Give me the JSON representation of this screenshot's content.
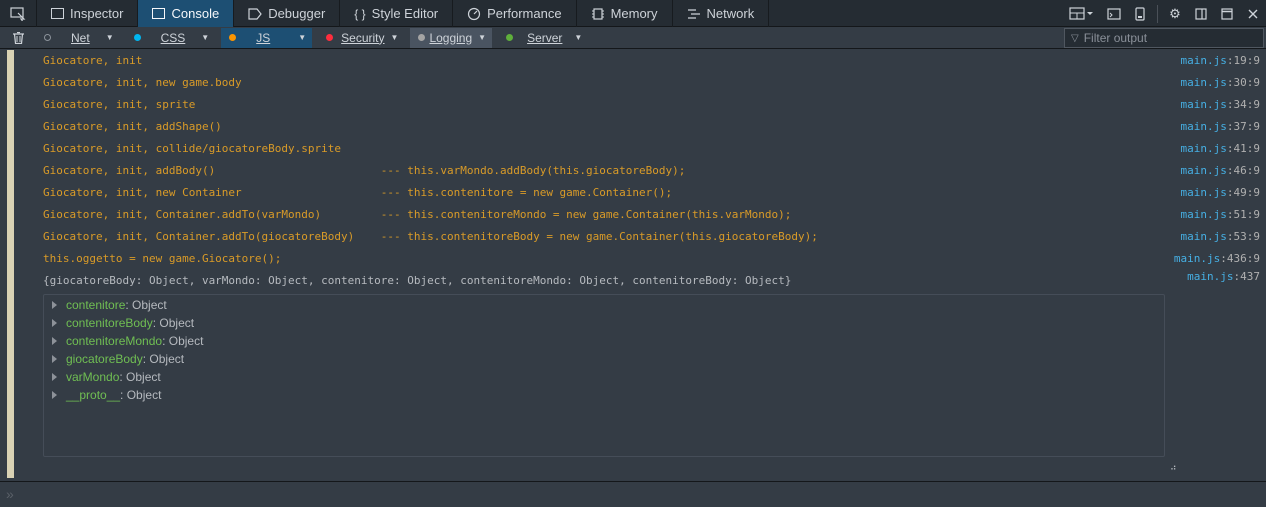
{
  "tabs": [
    {
      "label": "Inspector",
      "icon": "inspector-icon"
    },
    {
      "label": "Console",
      "icon": "console-icon"
    },
    {
      "label": "Debugger",
      "icon": "debugger-icon"
    },
    {
      "label": "Style Editor",
      "icon": "braces-icon"
    },
    {
      "label": "Performance",
      "icon": "performance-icon"
    },
    {
      "label": "Memory",
      "icon": "memory-icon"
    },
    {
      "label": "Network",
      "icon": "network-icon"
    }
  ],
  "selected_tab": "Console",
  "filters": [
    {
      "label": "Net",
      "dot_color": "#8c939b"
    },
    {
      "label": "CSS",
      "dot_color": "#00b6f0"
    },
    {
      "label": "JS",
      "dot_color": "#fb9500"
    },
    {
      "label": "Security",
      "dot_color": "#ff2d3d"
    },
    {
      "label": "Logging",
      "dot_color": "#a4a4a4"
    },
    {
      "label": "Server",
      "dot_color": "#5faf3b"
    }
  ],
  "filter_output": {
    "placeholder": "Filter output",
    "value": ""
  },
  "messages": [
    {
      "text": "Giocatore, init",
      "file": "main.js",
      "loc": ":19:9",
      "kind": "log"
    },
    {
      "text": "Giocatore, init, new game.body",
      "file": "main.js",
      "loc": ":30:9",
      "kind": "log"
    },
    {
      "text": "Giocatore, init, sprite",
      "file": "main.js",
      "loc": ":34:9",
      "kind": "log"
    },
    {
      "text": "Giocatore, init, addShape()",
      "file": "main.js",
      "loc": ":37:9",
      "kind": "log"
    },
    {
      "text": "Giocatore, init, collide/giocatoreBody.sprite",
      "file": "main.js",
      "loc": ":41:9",
      "kind": "log"
    },
    {
      "text": "Giocatore, init, addBody()                         --- this.varMondo.addBody(this.giocatoreBody);",
      "file": "main.js",
      "loc": ":46:9",
      "kind": "log"
    },
    {
      "text": "Giocatore, init, new Container                     --- this.contenitore = new game.Container();",
      "file": "main.js",
      "loc": ":49:9",
      "kind": "log"
    },
    {
      "text": "Giocatore, init, Container.addTo(varMondo)         --- this.contenitoreMondo = new game.Container(this.varMondo);",
      "file": "main.js",
      "loc": ":51:9",
      "kind": "log"
    },
    {
      "text": "Giocatore, init, Container.addTo(giocatoreBody)    --- this.contenitoreBody = new game.Container(this.giocatoreBody);",
      "file": "main.js",
      "loc": ":53:9",
      "kind": "log"
    },
    {
      "text": "this.oggetto = new game.Giocatore();",
      "file": "main.js",
      "loc": ":436:9",
      "kind": "log"
    },
    {
      "text": "{giocatoreBody: Object, varMondo: Object, contenitore: Object, contenitoreMondo: Object, contenitoreBody: Object}",
      "file": "main.js",
      "loc": ":437",
      "kind": "obj"
    }
  ],
  "object_properties": [
    {
      "key": "contenitore",
      "value": "Object"
    },
    {
      "key": "contenitoreBody",
      "value": "Object"
    },
    {
      "key": "contenitoreMondo",
      "value": "Object"
    },
    {
      "key": "giocatoreBody",
      "value": "Object"
    },
    {
      "key": "varMondo",
      "value": "Object"
    },
    {
      "key": "__proto__",
      "value": "Object"
    }
  ],
  "colors": {
    "selected_tab": "#1d4f73",
    "log_text": "#d99b28",
    "source_link": "#46afe3",
    "property_key": "#70bf53",
    "background": "#343c45"
  }
}
